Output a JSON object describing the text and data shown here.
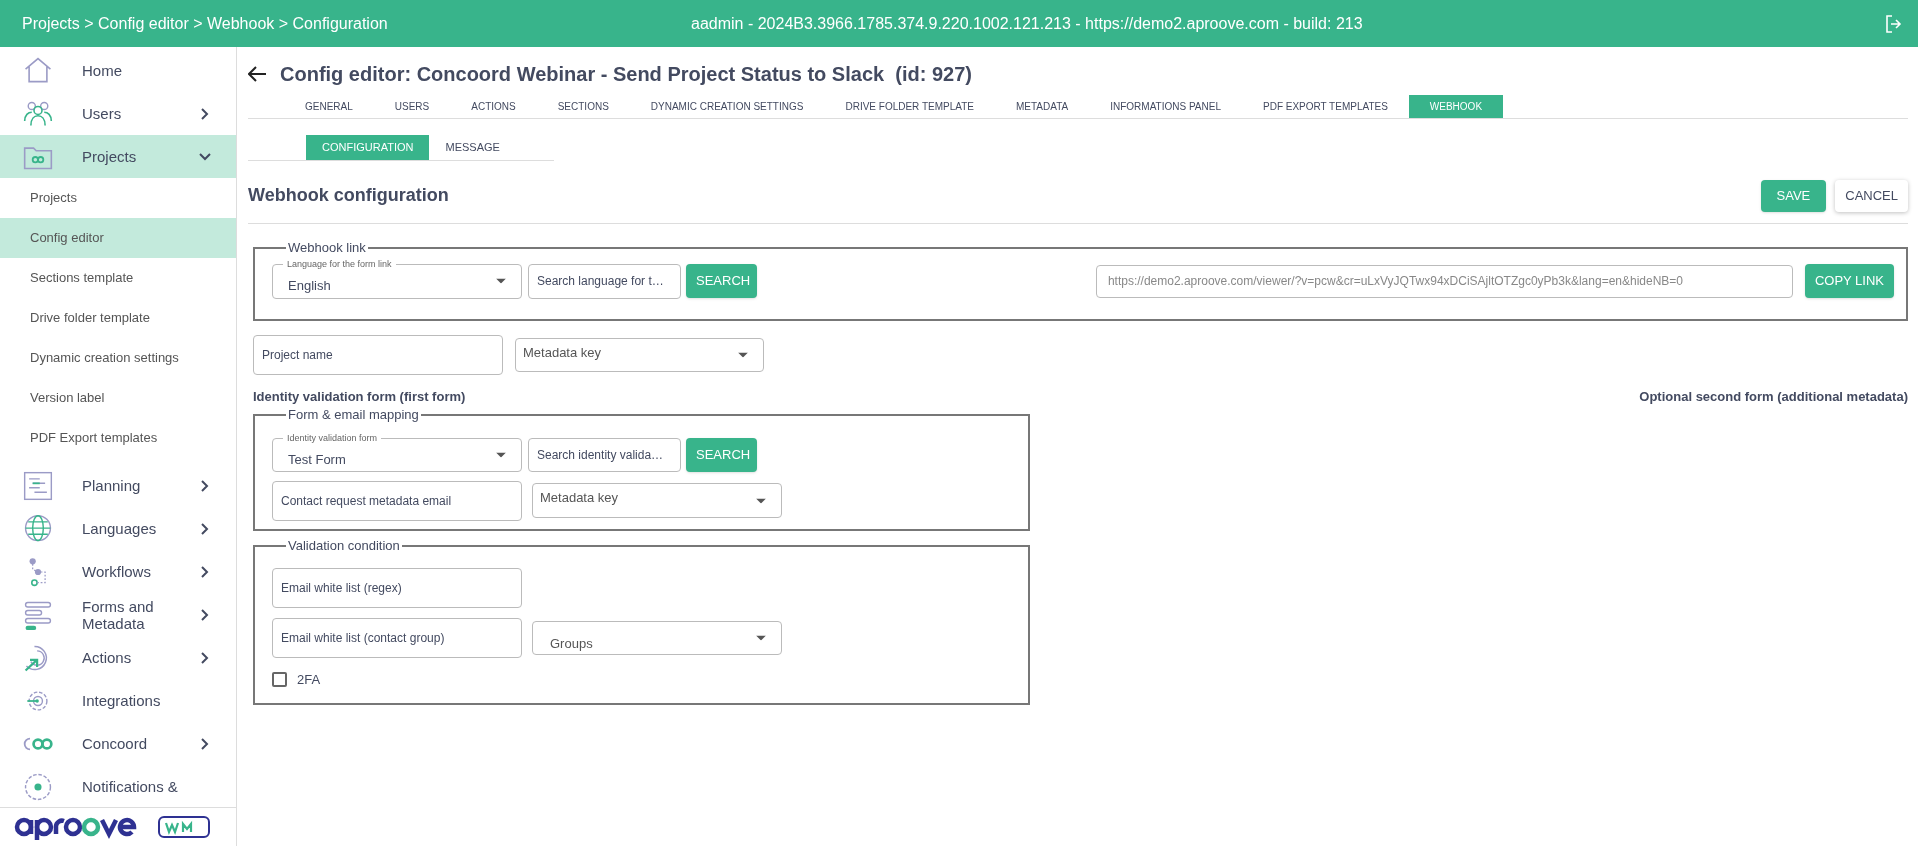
{
  "top_bar": {
    "breadcrumb": "Projects > Config editor > Webhook > Configuration",
    "session_info": "aadmin - 2024B3.3966.1785.374.9.220.1002.121.213 - https://demo2.aproove.com - build: 213"
  },
  "sidebar": {
    "items": [
      {
        "label": "Home",
        "selected": false
      },
      {
        "label": "Users",
        "selected": false,
        "expanded": false
      },
      {
        "label": "Projects",
        "selected": true,
        "expanded": true,
        "children": [
          {
            "label": "Projects",
            "selected": false
          },
          {
            "label": "Config editor",
            "selected": true
          },
          {
            "label": "Sections template",
            "selected": false
          },
          {
            "label": "Drive folder template",
            "selected": false
          },
          {
            "label": "Dynamic creation settings",
            "selected": false
          },
          {
            "label": "Version label",
            "selected": false
          },
          {
            "label": "PDF Export templates",
            "selected": false
          }
        ]
      },
      {
        "label": "Planning",
        "selected": false,
        "expanded": false
      },
      {
        "label": "Languages",
        "selected": false,
        "expanded": false
      },
      {
        "label": "Workflows",
        "selected": false,
        "expanded": false
      },
      {
        "label": "Forms and Metadata",
        "selected": false,
        "expanded": false
      },
      {
        "label": "Actions",
        "selected": false,
        "expanded": false
      },
      {
        "label": "Integrations",
        "selected": false
      },
      {
        "label": "Concoord",
        "selected": false,
        "expanded": false
      },
      {
        "label": "Notifications &",
        "selected": false
      }
    ]
  },
  "page": {
    "title": "Config editor: Concoord Webinar - Send Project Status to Slack  (id: 927)",
    "tabs": [
      {
        "label": "GENERAL",
        "selected": false
      },
      {
        "label": "USERS",
        "selected": false
      },
      {
        "label": "ACTIONS",
        "selected": false
      },
      {
        "label": "SECTIONS",
        "selected": false
      },
      {
        "label": "DYNAMIC CREATION SETTINGS",
        "selected": false
      },
      {
        "label": "DRIVE FOLDER TEMPLATE",
        "selected": false
      },
      {
        "label": "METADATA",
        "selected": false
      },
      {
        "label": "INFORMATIONS PANEL",
        "selected": false
      },
      {
        "label": "PDF EXPORT TEMPLATES",
        "selected": false
      },
      {
        "label": "WEBHOOK",
        "selected": true
      }
    ],
    "subtabs": [
      {
        "label": "CONFIGURATION",
        "selected": true
      },
      {
        "label": "MESSAGE",
        "selected": false
      }
    ],
    "section_title": "Webhook configuration",
    "buttons": {
      "save": "SAVE",
      "cancel": "CANCEL"
    },
    "webhook_link": {
      "legend": "Webhook link",
      "language_select": {
        "label": "Language for the form link",
        "value": "English"
      },
      "search_field": {
        "placeholder": "Search language for t…"
      },
      "search_button": "SEARCH",
      "link_field": {
        "value": "https://demo2.aproove.com/viewer/?v=pcw&cr=uLxVyJQTwx94xDCiSAjltOTZgc0yPb3k&lang=en&hideNB=0"
      },
      "copy_button": "COPY LINK"
    },
    "project_name_field": {
      "placeholder": "Project name"
    },
    "project_metadata_select": {
      "label": "Metadata key"
    },
    "identity_heading": "Identity validation form (first form)",
    "optional_heading": "Optional second form (additional metadata)",
    "form_mapping": {
      "legend": "Form & email mapping",
      "form_select": {
        "label": "Identity validation form",
        "value": "Test Form"
      },
      "search_field": {
        "placeholder": "Search identity valida…"
      },
      "search_button": "SEARCH",
      "email_field": {
        "placeholder": "Contact request metadata email"
      },
      "metadata_select": {
        "label": "Metadata key"
      }
    },
    "validation": {
      "legend": "Validation condition",
      "regex_field": {
        "placeholder": "Email white list (regex)"
      },
      "group_field": {
        "placeholder": "Email white list (contact group)"
      },
      "groups_select": {
        "label": "Groups"
      },
      "two_fa": {
        "label": "2FA",
        "checked": false
      }
    }
  }
}
